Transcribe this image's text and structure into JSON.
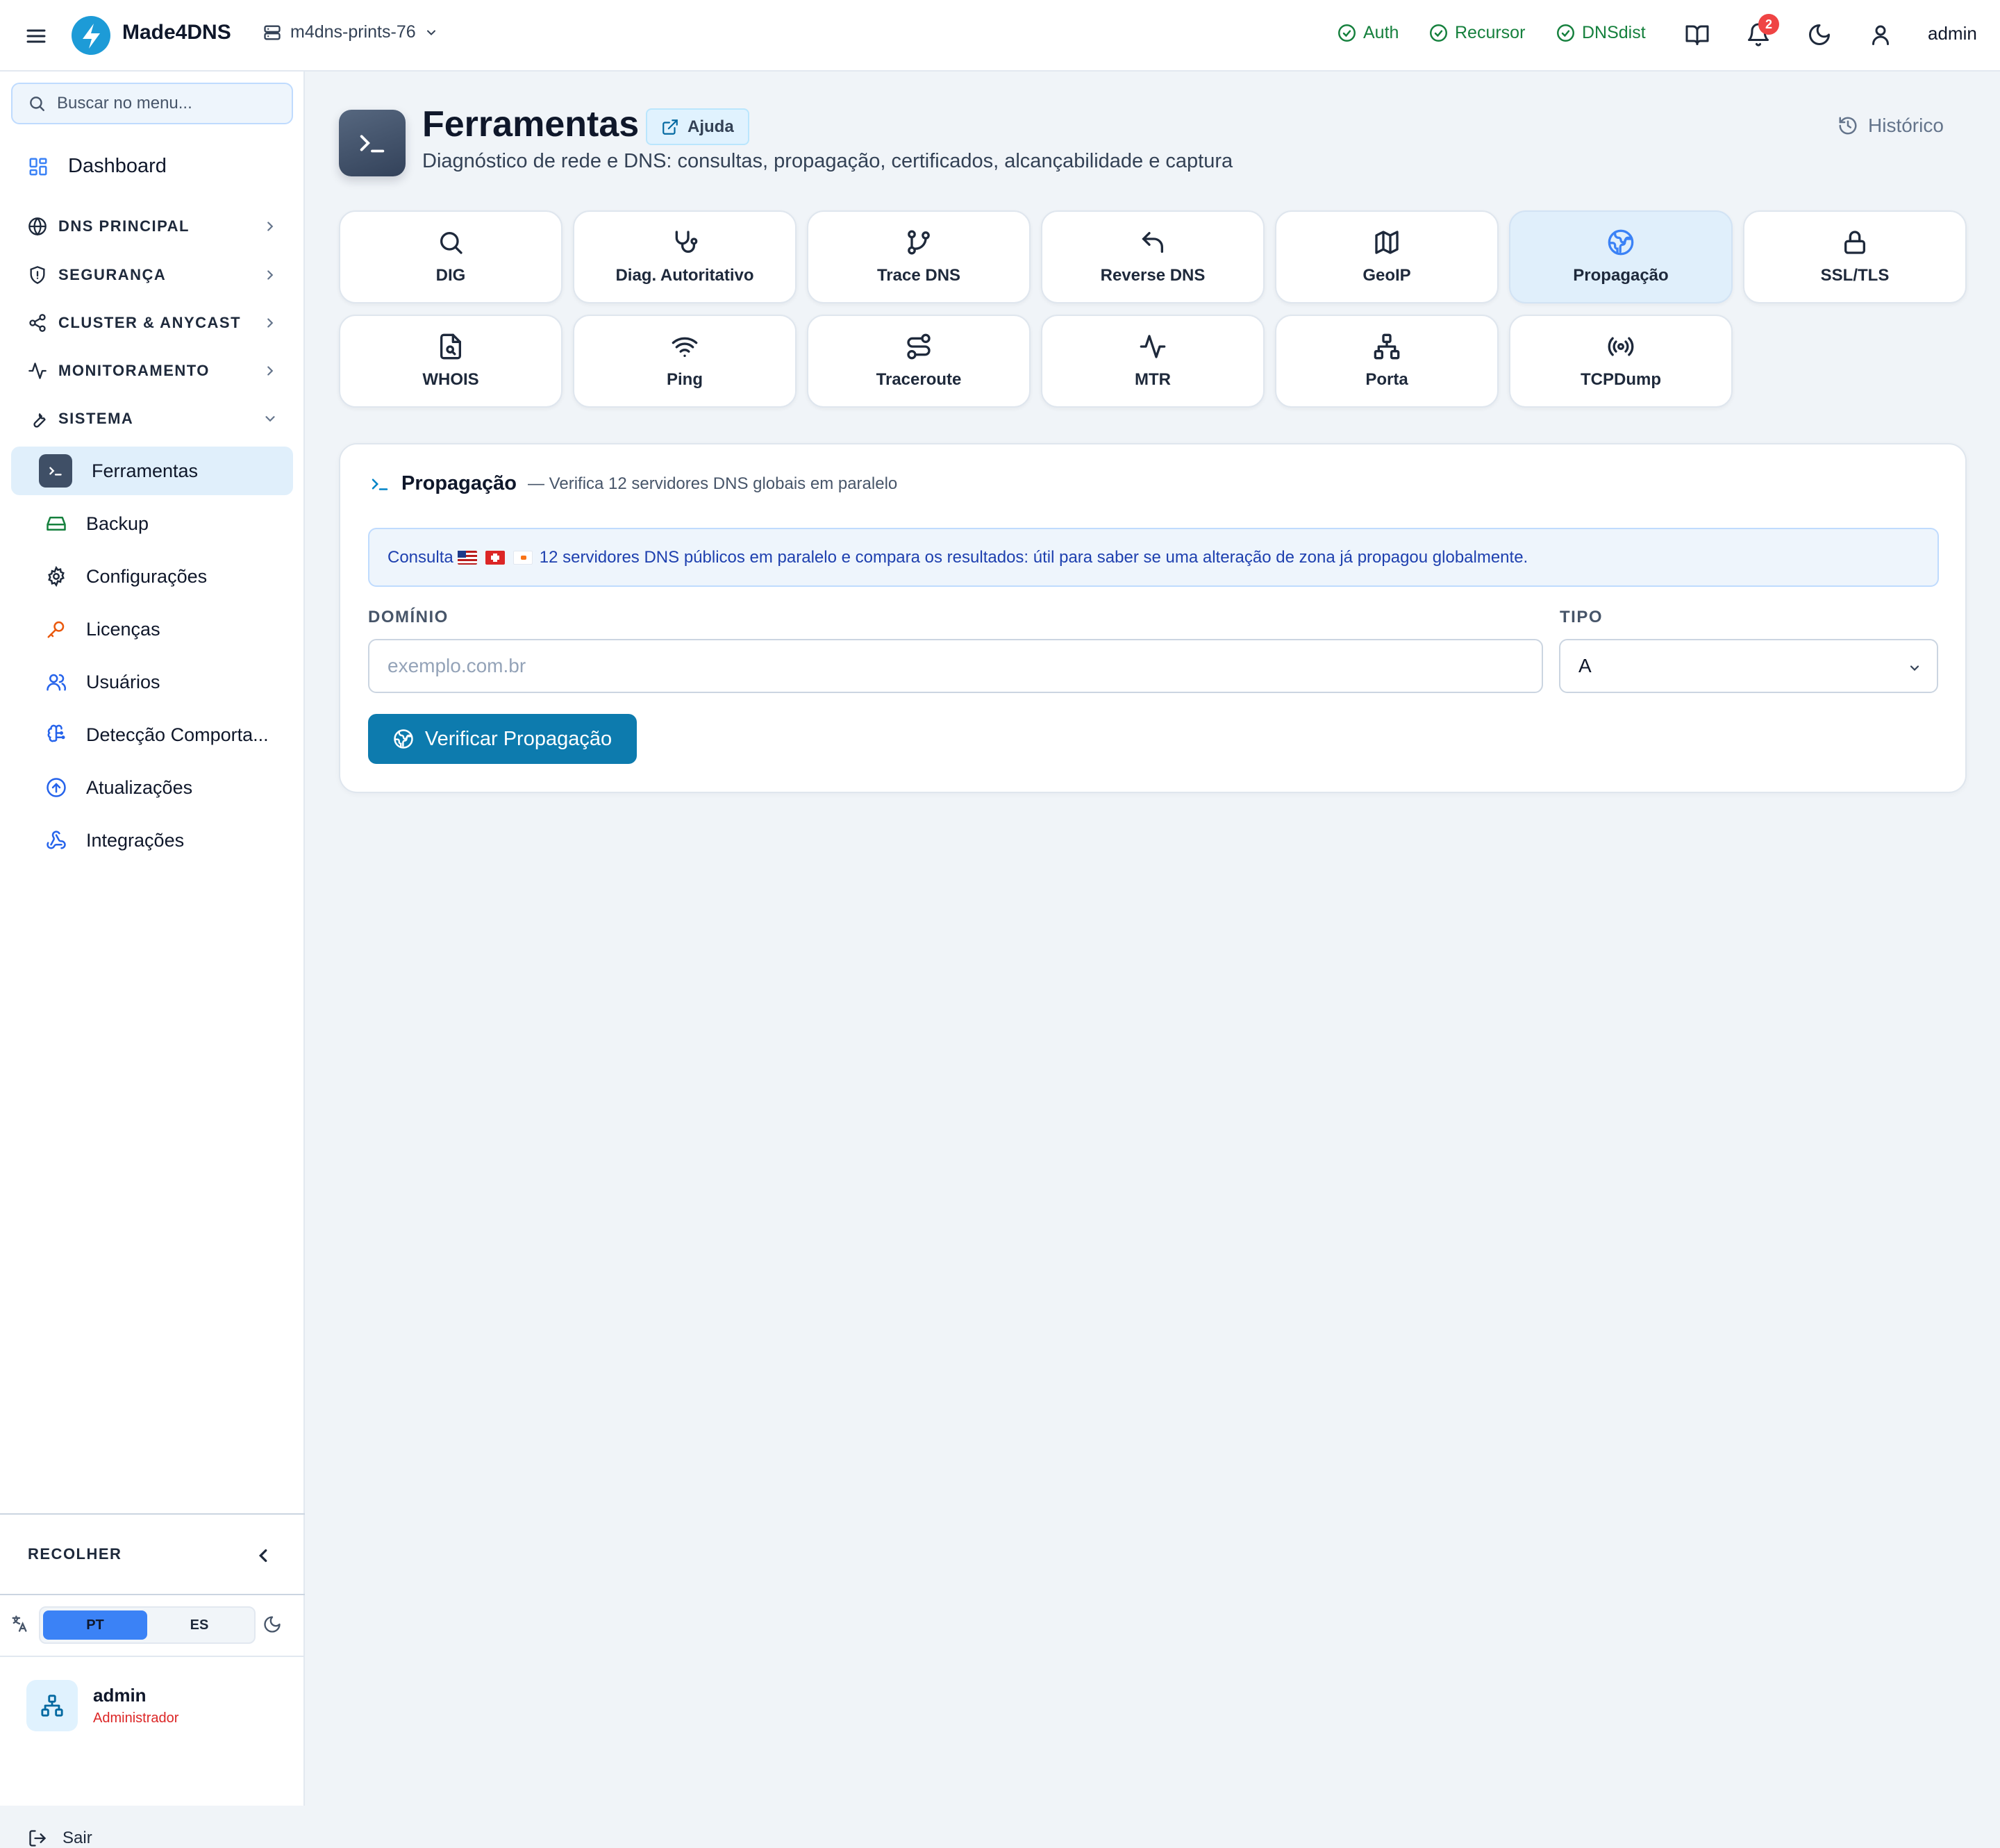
{
  "topbar": {
    "brand": "Made4DNS",
    "server": "m4dns-prints-76",
    "status": [
      {
        "label": "Auth",
        "color": "#15803d"
      },
      {
        "label": "Recursor",
        "color": "#15803d"
      },
      {
        "label": "DNSdist",
        "color": "#15803d"
      }
    ],
    "notifications_count": "2",
    "user": "admin"
  },
  "sidebar": {
    "search_placeholder": "Buscar no menu...",
    "dashboard": "Dashboard",
    "sections": [
      {
        "label": "DNS PRINCIPAL"
      },
      {
        "label": "SEGURANÇA"
      },
      {
        "label": "CLUSTER & ANYCAST"
      },
      {
        "label": "MONITORAMENTO"
      },
      {
        "label": "SISTEMA"
      }
    ],
    "items": [
      {
        "label": "Ferramentas",
        "icon": "terminal-icon"
      },
      {
        "label": "Backup",
        "icon": "hard-drive-icon"
      },
      {
        "label": "Configurações",
        "icon": "gear-icon"
      },
      {
        "label": "Licenças",
        "icon": "key-icon"
      },
      {
        "label": "Usuários",
        "icon": "users-icon"
      },
      {
        "label": "Detecção Comporta...",
        "icon": "brain-icon"
      },
      {
        "label": "Atualizações",
        "icon": "upload-circle-icon"
      },
      {
        "label": "Integrações",
        "icon": "webhook-icon"
      }
    ],
    "collapse_label": "RECOLHER",
    "languages": [
      "PT",
      "ES"
    ],
    "active_language": "PT",
    "profile": {
      "name": "admin",
      "role": "Administrador"
    },
    "logout": "Sair"
  },
  "page": {
    "title": "Ferramentas",
    "help": "Ajuda",
    "subtitle": "Diagnóstico de rede e DNS: consultas, propagação, certificados, alcançabilidade e captura",
    "history": "Histórico"
  },
  "tools": [
    {
      "label": "DIG",
      "icon": "search-icon"
    },
    {
      "label": "Diag. Autoritativo",
      "icon": "stethoscope-icon"
    },
    {
      "label": "Trace DNS",
      "icon": "git-branch-icon"
    },
    {
      "label": "Reverse DNS",
      "icon": "undo-arrow-icon"
    },
    {
      "label": "GeoIP",
      "icon": "map-icon"
    },
    {
      "label": "Propagação",
      "icon": "globe-icon",
      "active": true
    },
    {
      "label": "SSL/TLS",
      "icon": "lock-icon"
    },
    {
      "label": "WHOIS",
      "icon": "file-search-icon"
    },
    {
      "label": "Ping",
      "icon": "wifi-icon"
    },
    {
      "label": "Traceroute",
      "icon": "route-icon"
    },
    {
      "label": "MTR",
      "icon": "activity-icon"
    },
    {
      "label": "Porta",
      "icon": "network-icon"
    },
    {
      "label": "TCPDump",
      "icon": "radio-icon"
    }
  ],
  "panel": {
    "title": "Propagação",
    "description": "— Verifica 12 servidores DNS globais em paralelo",
    "info_prefix": "Consulta",
    "info_text": "12 servidores DNS públicos em paralelo e compara os resultados: útil para saber se uma alteração de zona já propagou globalmente.",
    "domain_label": "DOMÍNIO",
    "domain_placeholder": "exemplo.com.br",
    "domain_value": "",
    "type_label": "TIPO",
    "type_value": "A",
    "submit": "Verificar Propagação"
  },
  "colors": {
    "accent": "#0d7bae",
    "active_bg": "#e0effb",
    "status_ok": "#15803d",
    "danger": "#ef4444"
  }
}
